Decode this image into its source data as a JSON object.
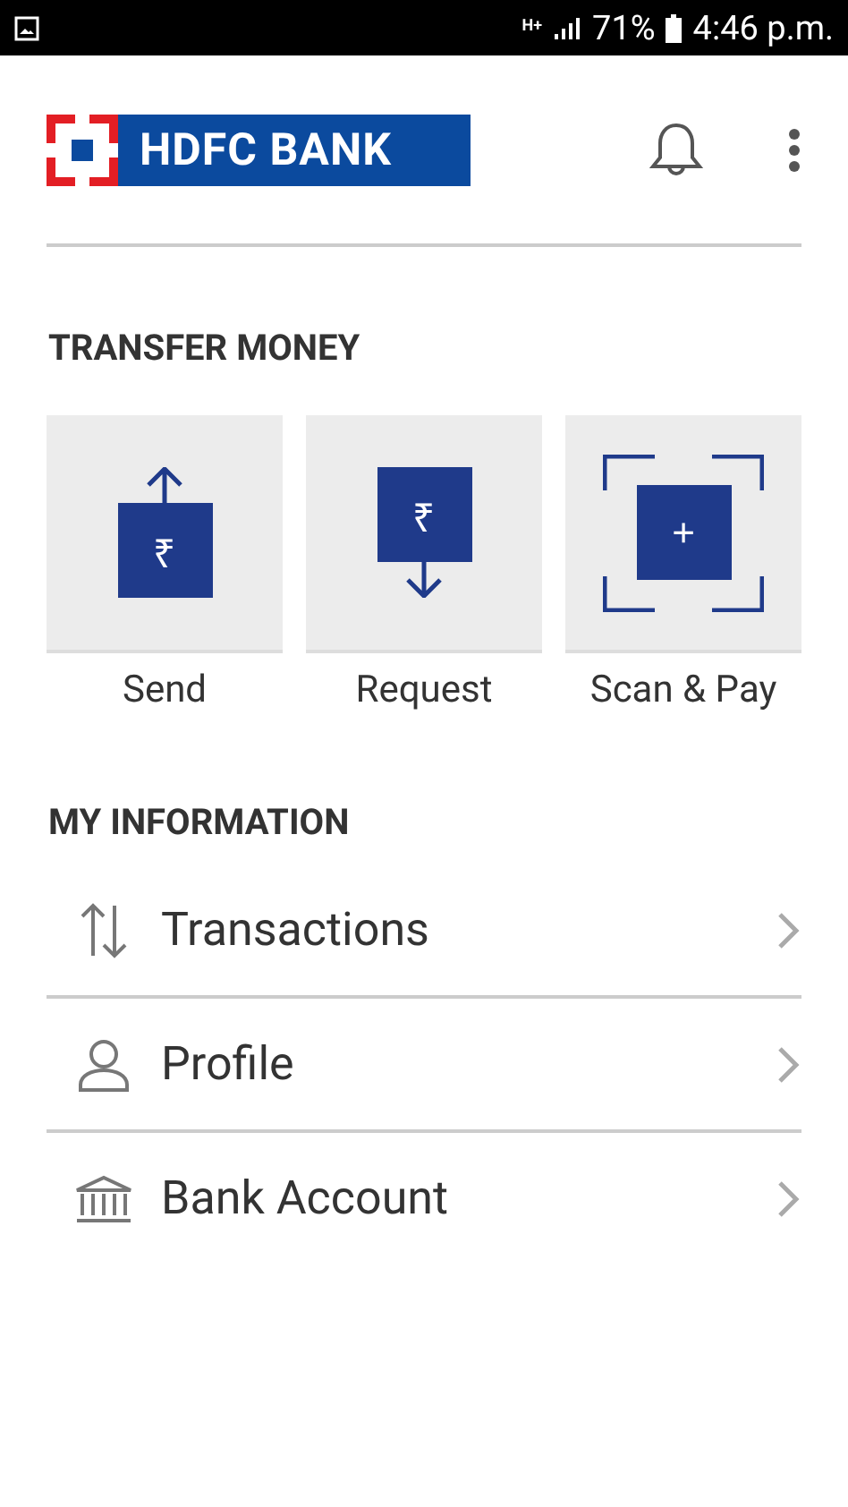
{
  "status_bar": {
    "network": "H+",
    "battery": "71%",
    "time": "4:46 p.m."
  },
  "header": {
    "logo_text": "HDFC BANK"
  },
  "transfer_money": {
    "title": "TRANSFER MONEY",
    "actions": [
      {
        "kind": "send",
        "symbol": "₹",
        "label": "Send"
      },
      {
        "kind": "request",
        "symbol": "₹",
        "label": "Request"
      },
      {
        "kind": "scan",
        "symbol": "+",
        "label": "Scan & Pay"
      }
    ]
  },
  "my_information": {
    "title": "MY INFORMATION",
    "items": [
      {
        "kind": "transactions",
        "label": "Transactions"
      },
      {
        "kind": "profile",
        "label": "Profile"
      },
      {
        "kind": "bank",
        "label": "Bank Account"
      }
    ]
  }
}
